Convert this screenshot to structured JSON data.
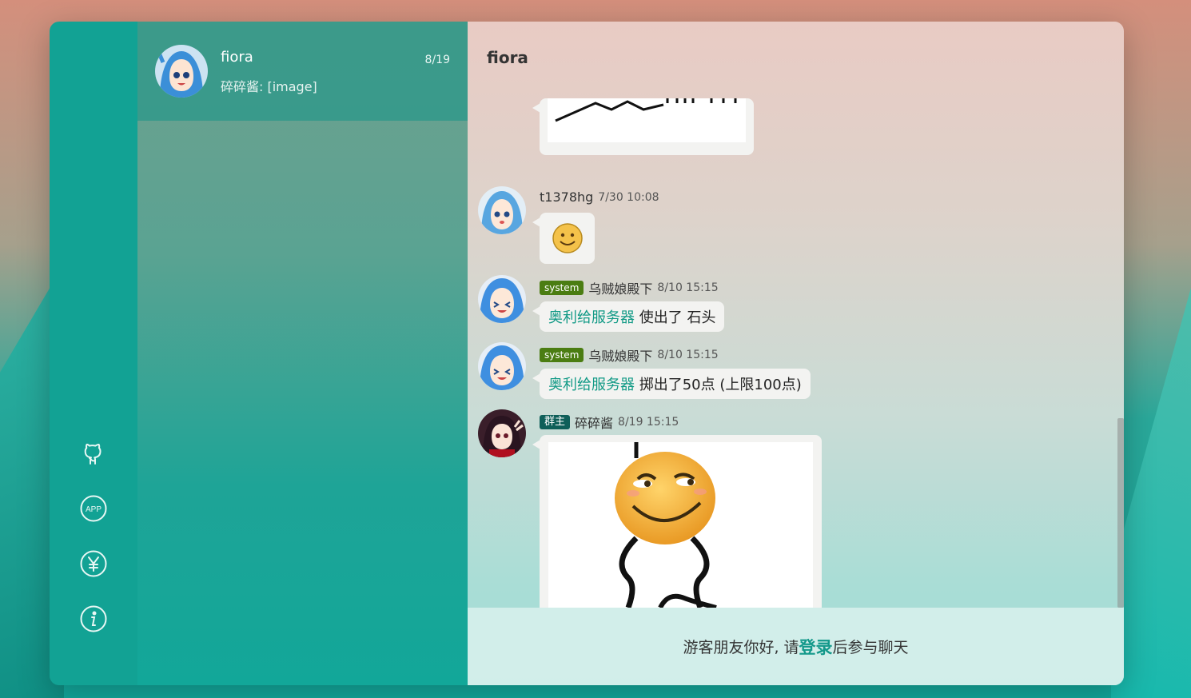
{
  "colors": {
    "accent": "#12a294",
    "link": "#129a86",
    "system_tag": "#4b7d12",
    "owner_tag": "#0f5f59"
  },
  "sidebar": {
    "icons": [
      "github-icon",
      "app-icon",
      "yen-icon",
      "info-icon"
    ],
    "app_label": "APP"
  },
  "conversation": {
    "name": "fiora",
    "time": "8/19",
    "preview": "碎碎酱: [image]"
  },
  "chat": {
    "title": "fiora",
    "messages": [
      {
        "id": "m1",
        "type": "image-partial",
        "sender": "",
        "time": ""
      },
      {
        "id": "m2",
        "sender": "t1378hg",
        "time": "7/30 10:08",
        "type": "emoji"
      },
      {
        "id": "m3",
        "tag": "system",
        "sender": "乌贼娘殿下",
        "time": "8/10 15:15",
        "highlight": "奥利给服务器",
        "text": " 使出了 石头"
      },
      {
        "id": "m4",
        "tag": "system",
        "sender": "乌贼娘殿下",
        "time": "8/10 15:15",
        "highlight": "奥利给服务器",
        "text": " 掷出了50点 (上限100点)"
      },
      {
        "id": "m5",
        "tag": "群主",
        "sender": "碎碎酱",
        "time": "8/19 15:15",
        "type": "image"
      }
    ]
  },
  "footer": {
    "prefix": "游客朋友你好, 请",
    "login": "登录",
    "suffix": "后参与聊天"
  }
}
